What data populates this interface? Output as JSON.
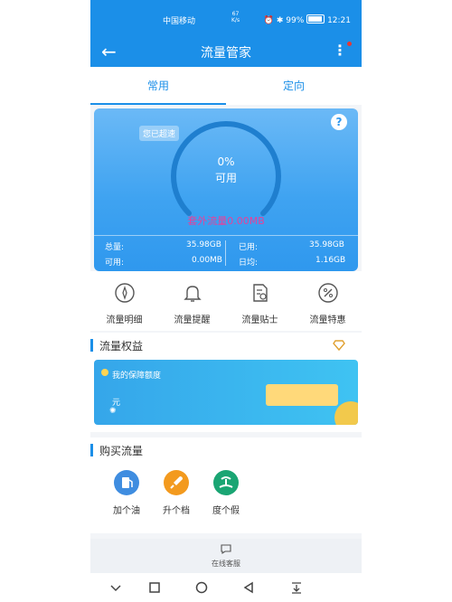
{
  "status_bar": {
    "carrier": "中国移动",
    "speed_value": "67",
    "speed_unit": "K/s",
    "battery": "99%",
    "time": "12:21"
  },
  "header": {
    "title": "流量管家"
  },
  "tabs": [
    {
      "label": "常用"
    },
    {
      "label": "定向"
    }
  ],
  "usage_card": {
    "badge": "您已超速",
    "percent": "0%",
    "available_label": "可用",
    "extra_traffic": "套外流量0.00MB",
    "gauge_fraction": 0,
    "stats": {
      "total_label": "总量:",
      "total_value": "35.98GB",
      "used_label": "已用:",
      "used_value": "35.98GB",
      "avail_label": "可用:",
      "avail_value": "0.00MB",
      "daily_label": "日均:",
      "daily_value": "1.16GB"
    }
  },
  "quick_actions": [
    {
      "label": "流量明细",
      "icon": "compass-icon"
    },
    {
      "label": "流量提醒",
      "icon": "bell-icon"
    },
    {
      "label": "流量贴士",
      "icon": "document-search-icon"
    },
    {
      "label": "流量特惠",
      "icon": "percent-icon"
    }
  ],
  "equity": {
    "title": "流量权益",
    "card_title": "我的保障额度",
    "unit": "元"
  },
  "buy": {
    "title": "购买流量",
    "items": [
      {
        "label": "加个油",
        "icon": "fuel-icon",
        "color": "#3f8de0"
      },
      {
        "label": "升个档",
        "icon": "rocket-icon",
        "color": "#f39a1e"
      },
      {
        "label": "度个假",
        "icon": "island-icon",
        "color": "#1aa573"
      }
    ]
  },
  "service": {
    "label": "在线客服"
  },
  "colors": {
    "primary": "#1b8fe8",
    "accent_pink": "#e8409a",
    "gold": "#f2c94c"
  }
}
